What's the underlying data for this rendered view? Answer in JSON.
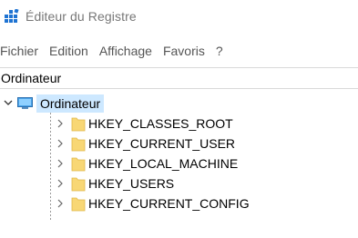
{
  "window": {
    "title": "Éditeur du Registre",
    "icon": "regedit-icon"
  },
  "menu": {
    "items": [
      {
        "label": "Fichier"
      },
      {
        "label": "Edition"
      },
      {
        "label": "Affichage"
      },
      {
        "label": "Favoris"
      },
      {
        "label": "?"
      }
    ]
  },
  "address": {
    "value": "Ordinateur"
  },
  "tree": {
    "root": {
      "label": "Ordinateur",
      "icon": "computer-icon",
      "expanded": true,
      "selected": true
    },
    "children": [
      {
        "label": "HKEY_CLASSES_ROOT",
        "icon": "folder-icon",
        "expanded": false
      },
      {
        "label": "HKEY_CURRENT_USER",
        "icon": "folder-icon",
        "expanded": false
      },
      {
        "label": "HKEY_LOCAL_MACHINE",
        "icon": "folder-icon",
        "expanded": false
      },
      {
        "label": "HKEY_USERS",
        "icon": "folder-icon",
        "expanded": false
      },
      {
        "label": "HKEY_CURRENT_CONFIG",
        "icon": "folder-icon",
        "expanded": false
      }
    ]
  },
  "colors": {
    "selection": "#cde8ff",
    "folder": "#f8d775",
    "app_icon_blue": "#1e73d2"
  }
}
